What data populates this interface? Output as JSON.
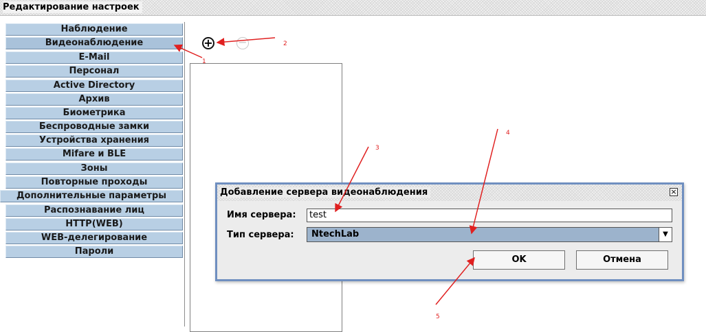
{
  "window": {
    "title": "Редактирование настроек"
  },
  "sidebar": {
    "items": [
      {
        "label": "Наблюдение"
      },
      {
        "label": "Видеонаблюдение"
      },
      {
        "label": "E-Mail"
      },
      {
        "label": "Персонал"
      },
      {
        "label": "Active Directory"
      },
      {
        "label": "Архив"
      },
      {
        "label": "Биометрика"
      },
      {
        "label": "Беспроводные замки"
      },
      {
        "label": "Устройства хранения"
      },
      {
        "label": "Mifare и BLE"
      },
      {
        "label": "Зоны"
      },
      {
        "label": "Повторные проходы"
      },
      {
        "label": "Дополнительные параметры"
      },
      {
        "label": "Распознавание лиц"
      },
      {
        "label": "HTTP(WEB)"
      },
      {
        "label": "WEB-делегирование"
      },
      {
        "label": "Пароли"
      }
    ],
    "selected": "Видеонаблюдение"
  },
  "toolbar": {
    "add_symbol": "+",
    "remove_symbol": "−"
  },
  "dialog": {
    "title": "Добавление сервера видеонаблюдения",
    "close_symbol": "×",
    "server_name_label": "Имя сервера:",
    "server_name_value": "test",
    "server_type_label": "Тип сервера:",
    "server_type_value": "NtechLab",
    "ok_label": "OK",
    "cancel_label": "Отмена"
  },
  "annotations": {
    "color": "#e02020",
    "labels": [
      "1",
      "2",
      "3",
      "4",
      "5"
    ]
  },
  "colors": {
    "sidebar_item": "#b8cfe4",
    "dialog_border": "#6f8fc0",
    "select_bg": "#9cb3cc"
  }
}
